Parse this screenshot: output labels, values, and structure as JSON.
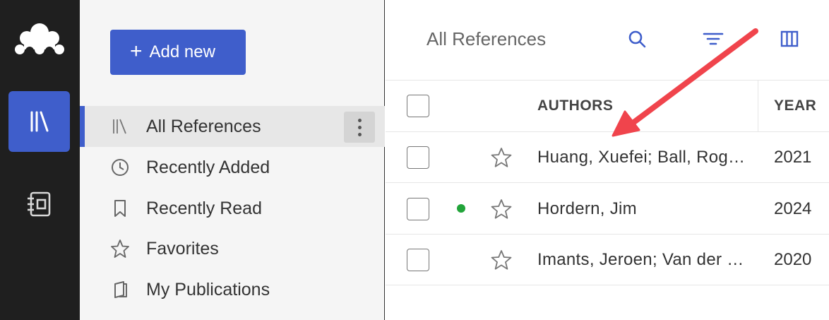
{
  "sidebar": {
    "add_new_label": "Add new",
    "items": [
      {
        "label": "All References",
        "icon": "library-icon",
        "active": true
      },
      {
        "label": "Recently Added",
        "icon": "clock-icon"
      },
      {
        "label": "Recently Read",
        "icon": "bookmark-icon"
      },
      {
        "label": "Favorites",
        "icon": "star-outline-icon"
      },
      {
        "label": "My Publications",
        "icon": "publications-icon"
      }
    ]
  },
  "main": {
    "title": "All References",
    "columns": {
      "authors": "AUTHORS",
      "year": "YEAR"
    },
    "rows": [
      {
        "authors": "Huang, Xuefei; Ball, Roger; Wang, Wenfeng",
        "year": "2021",
        "unread": false
      },
      {
        "authors": "Hordern, Jim",
        "year": "2024",
        "unread": true
      },
      {
        "authors": "Imants, Jeroen; Van der Want, Anna",
        "year": "2020",
        "unread": false
      }
    ]
  },
  "colors": {
    "accent": "#3f5ecb",
    "rail": "#1f1f1f",
    "unread_dot": "#22a43a",
    "annotation_arrow": "#f0444c"
  }
}
